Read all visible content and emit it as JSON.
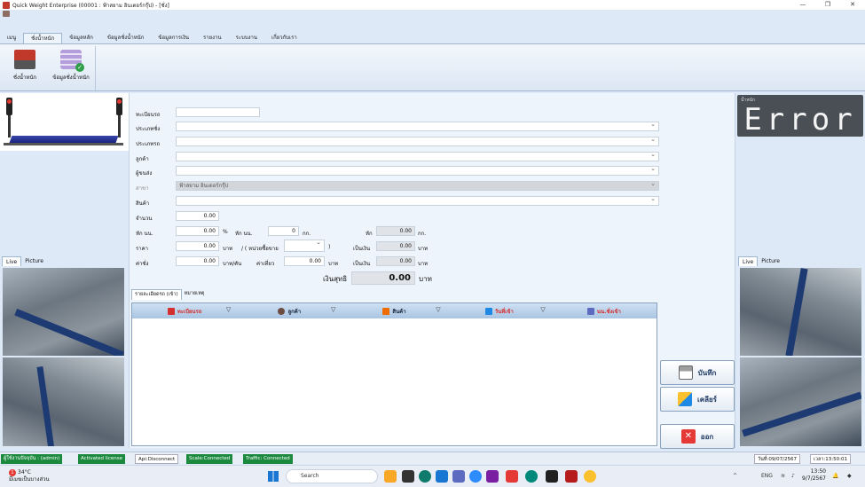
{
  "window": {
    "title": "Quick Weight Enterprise (00001 : ฟ้าสยาม อินเตอร์กรุ๊ป) - [ชั่ง]",
    "controls": [
      "—",
      "❐",
      "✕"
    ]
  },
  "ribbon": {
    "tabs": [
      "เมนู",
      "ชั่งน้ำหนัก",
      "ข้อมูลหลัก",
      "ข้อมูลชั่งน้ำหนัก",
      "ข้อมูลการเงิน",
      "รายงาน",
      "ระบบงาน",
      "เกี่ยวกับเรา"
    ],
    "active_tab": 1,
    "buttons": [
      "ชั่งน้ำหนัก",
      "ข้อมูลชั่งน้ำหนัก"
    ]
  },
  "display": {
    "label": "น้ำหนัก",
    "value": "Error"
  },
  "cameras": {
    "left_tabs": [
      "Live",
      "Picture"
    ],
    "right_tabs": [
      "Live",
      "Picture"
    ]
  },
  "form": {
    "plate_label": "ทะเบียนรถ",
    "plate_value": "",
    "weigh_type_label": "ประเภทชั่ง",
    "truck_type_label": "ประเภทรถ",
    "customer_label": "ลูกค้า",
    "sender_label": "ผู้ขนส่ง",
    "branch_label": "สาขา",
    "branch_value": "ฟ้าสยาม อินเตอร์กรุ๊ป",
    "product_label": "สินค้า",
    "qty_label": "จำนวน",
    "qty_value": "0.00",
    "deduct_label": "หัก นน.",
    "deduct_value": "0.00",
    "percent_unit": "%",
    "deduct_weight_label": "หัก นน.",
    "deduct_weight_value": "0",
    "kg_unit": "กก.",
    "deduct_right_label": "หัก",
    "deduct_right_value": "0.00",
    "deduct_right_unit": "กก.",
    "price_label": "ราคา",
    "price_value": "0.00",
    "baht_unit": "บาท",
    "per_unit_label": "/ ( หน่วยซื้อขาย",
    "per_unit_close": ")",
    "amount_label": "เป็นเงิน",
    "amount_value": "0.00",
    "amount_unit": "บาท",
    "fee_label": "ค่าชั่ง",
    "fee_value": "0.00",
    "fee_unit": "บาท/คัน",
    "trip_label": "ค่าเที่ยว",
    "trip_value": "0.00",
    "trip_unit": "บาท",
    "amount2_label": "เป็นเงิน",
    "amount2_value": "0.00",
    "amount2_unit": "บาท",
    "net_label": "เงินสุทธิ",
    "net_value": "0.00",
    "net_unit": "บาท"
  },
  "history": {
    "tabs": [
      "รายละเอียดรถ (เข้า)",
      "หมายเหตุ"
    ],
    "columns": [
      {
        "label": "ทะเบียนรถ",
        "color": "#d32f2f",
        "icon": "truck-icon"
      },
      {
        "label": "ลูกค้า",
        "color": "#1a2a40",
        "icon": "person-icon"
      },
      {
        "label": "สินค้า",
        "color": "#1a2a40",
        "icon": "box-icon"
      },
      {
        "label": "วันที่เข้า",
        "color": "#d32f2f",
        "icon": "calendar-icon"
      },
      {
        "label": "นน.ชั่งเข้า",
        "color": "#d32f2f",
        "icon": "weight-icon"
      }
    ]
  },
  "actions": {
    "save": "บันทึก",
    "clear": "เคลียร์",
    "exit": "ออก"
  },
  "status": {
    "user": "ผู้ใช้งานปัจจุบัน : (admin)",
    "license": "Activated license",
    "api": "Api:Disconnect",
    "scale": "Scale:Connected",
    "traffic": "Traffic: Connected",
    "date": "วันที่:09/07/2567",
    "time": "เวลา:13:50:01"
  },
  "taskbar": {
    "weather_temp": "34°C",
    "weather_desc": "มีเมฆเป็นบางส่วน",
    "weather_badge": "1",
    "search_placeholder": "Search",
    "lang": "ENG",
    "clock_time": "13:50",
    "clock_date": "9/7/2567"
  }
}
